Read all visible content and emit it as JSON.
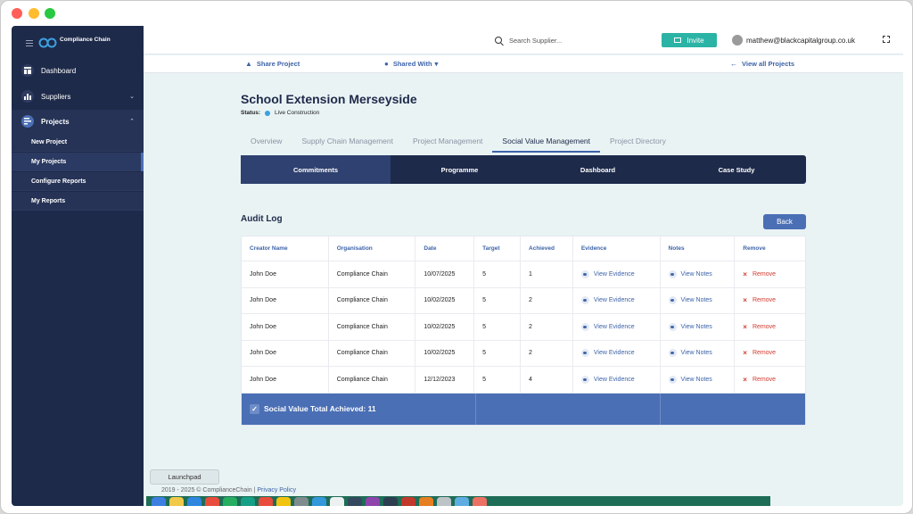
{
  "sidebar": {
    "brand": "Compliance Chain",
    "items": [
      {
        "label": "Dashboard",
        "icon": "dashboard-icon"
      },
      {
        "label": "Suppliers",
        "icon": "chart-icon"
      },
      {
        "label": "Projects",
        "icon": "projects-icon"
      }
    ],
    "subitems": [
      "New Project",
      "My Projects",
      "Configure Reports",
      "My Reports"
    ]
  },
  "topbar": {
    "search_placeholder": "Search Supplier...",
    "invite_label": "Invite",
    "user_email": "matthew@blackcapitalgroup.co.uk"
  },
  "subbar": {
    "share": "Share Project",
    "shared_with": "Shared With",
    "view_all": "View all Projects"
  },
  "project": {
    "title": "School Extension Merseyside",
    "status_label": "Status:",
    "status_value": "Live Construction"
  },
  "tabs": [
    "Overview",
    "Supply Chain Management",
    "Project Management",
    "Social Value Management",
    "Project Directory"
  ],
  "active_tab": "Social Value Management",
  "subtabs": [
    "Commitments",
    "Programme",
    "Dashboard",
    "Case Study"
  ],
  "active_subtab": "Commitments",
  "audit": {
    "title": "Audit Log",
    "back_label": "Back",
    "headers": [
      "Creator Name",
      "Organisation",
      "Date",
      "Target",
      "Achieved",
      "Evidence",
      "Notes",
      "Remove"
    ],
    "rows": [
      {
        "creator": "John Doe",
        "org": "Compliance Chain",
        "date": "10/07/2025",
        "target": "5",
        "achieved": "1",
        "evidence": "View Evidence",
        "notes": "View Notes",
        "remove": "Remove"
      },
      {
        "creator": "John Doe",
        "org": "Compliance Chain",
        "date": "10/02/2025",
        "target": "5",
        "achieved": "2",
        "evidence": "View Evidence",
        "notes": "View Notes",
        "remove": "Remove"
      },
      {
        "creator": "John Doe",
        "org": "Compliance Chain",
        "date": "10/02/2025",
        "target": "5",
        "achieved": "2",
        "evidence": "View Evidence",
        "notes": "View Notes",
        "remove": "Remove"
      },
      {
        "creator": "John Doe",
        "org": "Compliance Chain",
        "date": "10/02/2025",
        "target": "5",
        "achieved": "2",
        "evidence": "View Evidence",
        "notes": "View Notes",
        "remove": "Remove"
      },
      {
        "creator": "John Doe",
        "org": "Compliance Chain",
        "date": "12/12/2023",
        "target": "5",
        "achieved": "4",
        "evidence": "View Evidence",
        "notes": "View Notes",
        "remove": "Remove"
      }
    ],
    "total_label": "Social Value Total Achieved: 11"
  },
  "footer": {
    "copyright": "2019 - 2025 © ComplianceChain |",
    "privacy": "Privacy Policy"
  },
  "tooltip": "Launchpad",
  "colors": {
    "sidebar": "#1e2a4a",
    "accent": "#4a6fb5",
    "invite": "#2bb3a6",
    "remove": "#d23a2f"
  }
}
